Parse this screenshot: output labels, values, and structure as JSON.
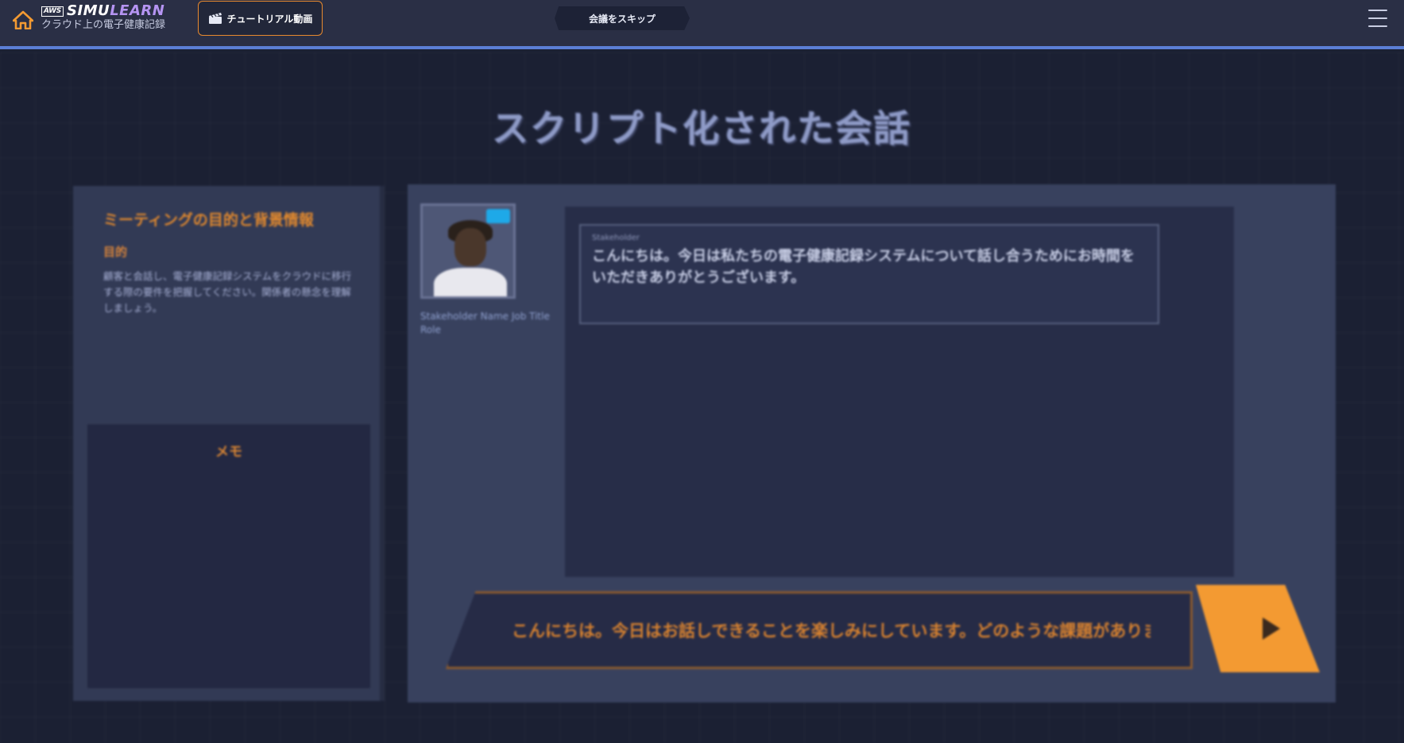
{
  "header": {
    "home_icon": "home-icon",
    "brand_badge": "AWS",
    "brand_name_part1": "SIMU",
    "brand_name_part2": "LEARN",
    "brand_subtitle": "クラウド上の電子健康記録",
    "tutorial_label": "チュートリアル動画",
    "tutorial_icon": "clapperboard-icon",
    "skip_label": "会議をスキップ",
    "menu_icon": "hamburger-menu-icon",
    "accent_color": "#5b7fd6",
    "tutorial_border_color": "#e8892e"
  },
  "stage": {
    "title": "スクリプト化された会話",
    "scenario": {
      "heading": "ミーティングの目的と背景情報",
      "subheading": "目的",
      "description": "顧客と会話し、電子健康記録システムをクラウドに移行する際の要件を把握してください。関係者の懸念を理解しましょう。",
      "notes_title": "メモ"
    },
    "conversation": {
      "speaker_name": "Stakeholder Name Job Title Role",
      "bubble_label": "Stakeholder",
      "bubble_text": "こんにちは。今日は私たちの電子健康記録システムについて話し合うためにお時間をいただきありがとうございます。",
      "response_option": "こんにちは。今日はお話しできることを楽しみにしています。どのような課題がありますか？",
      "send_icon": "play-arrow-icon",
      "send_color": "#f39a32",
      "badge_color": "#1ea9e8"
    }
  }
}
